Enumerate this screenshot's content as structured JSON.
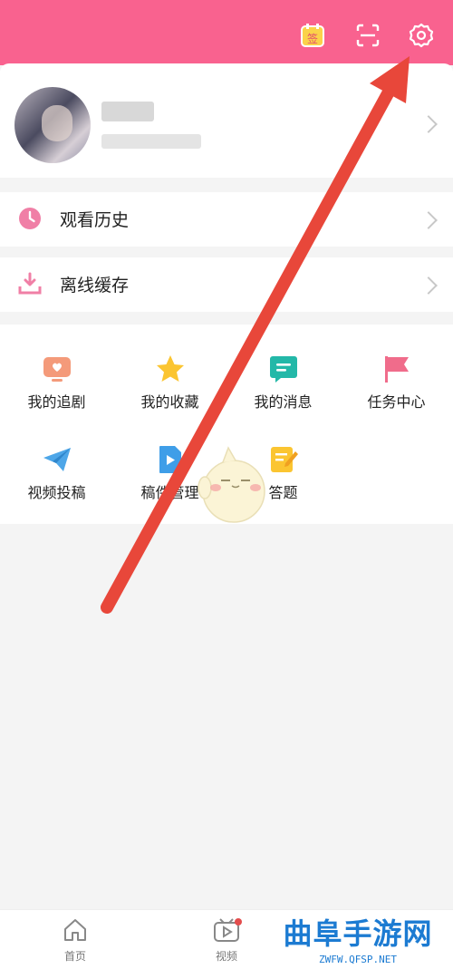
{
  "header": {
    "icons": [
      "checkin-calendar-icon",
      "scan-icon",
      "gear-icon"
    ],
    "checkin_badge": "签"
  },
  "menu_rows": [
    {
      "label": "观看历史",
      "icon": "clock-icon"
    },
    {
      "label": "离线缓存",
      "icon": "download-icon"
    }
  ],
  "grid_items": [
    {
      "label": "我的追剧",
      "icon": "tv-heart-icon"
    },
    {
      "label": "我的收藏",
      "icon": "star-icon"
    },
    {
      "label": "我的消息",
      "icon": "message-icon"
    },
    {
      "label": "任务中心",
      "icon": "flag-icon"
    },
    {
      "label": "视频投稿",
      "icon": "paper-plane-icon"
    },
    {
      "label": "稿件管理",
      "icon": "video-file-icon"
    },
    {
      "label": "答题",
      "icon": "pencil-note-icon"
    }
  ],
  "bottom_nav": [
    {
      "label": "首页",
      "icon": "home-icon"
    },
    {
      "label": "视频",
      "icon": "video-icon"
    }
  ],
  "watermark": {
    "title": "曲阜手游网",
    "url": "ZWFW.QFSP.NET"
  },
  "colors": {
    "brand": "#f9628f",
    "arrow": "#e8473a",
    "watermark": "#1c7bd2"
  }
}
